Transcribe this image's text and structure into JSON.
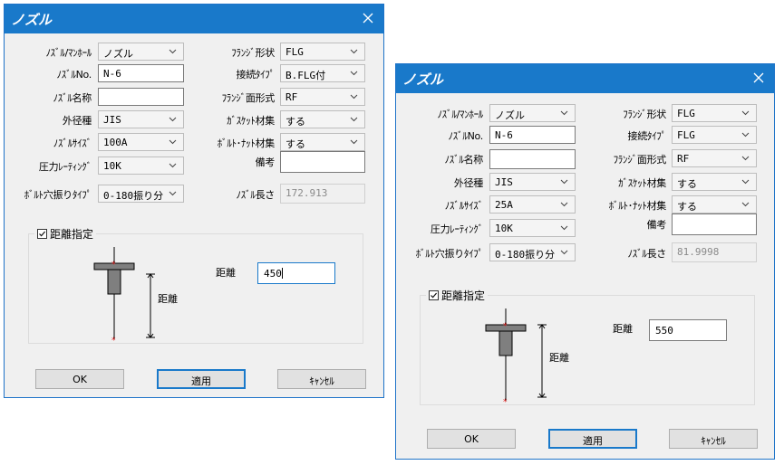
{
  "dialogs": [
    {
      "title": "ノズル",
      "fields": {
        "nozzle_manhole": {
          "label": "ﾉｽﾞﾙ/ﾏﾝﾎｰﾙ",
          "value": "ノズル"
        },
        "nozzle_no": {
          "label": "ﾉｽﾞﾙNo.",
          "value": "N-6"
        },
        "nozzle_name": {
          "label": "ﾉｽﾞﾙ名称",
          "value": ""
        },
        "outer_diameter": {
          "label": "外径種",
          "value": "JIS"
        },
        "nozzle_size": {
          "label": "ﾉｽﾞﾙｻｲｽﾞ",
          "value": "100A"
        },
        "pressure_rating": {
          "label": "圧力ﾚｰﾃｨﾝｸﾞ",
          "value": "10K"
        },
        "bolt_hole": {
          "label": "ﾎﾞﾙﾄ穴振りﾀｲﾌﾟ",
          "value": "0-180振り分"
        },
        "flange_shape": {
          "label": "ﾌﾗﾝｼﾞ形状",
          "value": "FLG"
        },
        "connection_type": {
          "label": "接続ﾀｲﾌﾟ",
          "value": "B.FLG付"
        },
        "flange_face": {
          "label": "ﾌﾗﾝｼﾞ面形式",
          "value": "RF"
        },
        "gasket": {
          "label": "ｶﾞｽｹｯﾄ材集",
          "value": "する"
        },
        "bolt_nut": {
          "label": "ﾎﾞﾙﾄ･ﾅｯﾄ材集",
          "value": "する"
        },
        "remarks": {
          "label": "備考",
          "value": ""
        },
        "nozzle_length": {
          "label": "ﾉｽﾞﾙ長さ",
          "value": "172.913"
        }
      },
      "distance_group": {
        "label": "距離指定",
        "checked": true,
        "figure_label": "距離",
        "distance_label": "距離",
        "distance_value": "450"
      },
      "buttons": {
        "ok": "OK",
        "apply": "適用",
        "cancel": "ｷｬﾝｾﾙ"
      }
    },
    {
      "title": "ノズル",
      "fields": {
        "nozzle_manhole": {
          "label": "ﾉｽﾞﾙ/ﾏﾝﾎｰﾙ",
          "value": "ノズル"
        },
        "nozzle_no": {
          "label": "ﾉｽﾞﾙNo.",
          "value": "N-6"
        },
        "nozzle_name": {
          "label": "ﾉｽﾞﾙ名称",
          "value": ""
        },
        "outer_diameter": {
          "label": "外径種",
          "value": "JIS"
        },
        "nozzle_size": {
          "label": "ﾉｽﾞﾙｻｲｽﾞ",
          "value": "25A"
        },
        "pressure_rating": {
          "label": "圧力ﾚｰﾃｨﾝｸﾞ",
          "value": "10K"
        },
        "bolt_hole": {
          "label": "ﾎﾞﾙﾄ穴振りﾀｲﾌﾟ",
          "value": "0-180振り分"
        },
        "flange_shape": {
          "label": "ﾌﾗﾝｼﾞ形状",
          "value": "FLG"
        },
        "connection_type": {
          "label": "接続ﾀｲﾌﾟ",
          "value": "FLG"
        },
        "flange_face": {
          "label": "ﾌﾗﾝｼﾞ面形式",
          "value": "RF"
        },
        "gasket": {
          "label": "ｶﾞｽｹｯﾄ材集",
          "value": "する"
        },
        "bolt_nut": {
          "label": "ﾎﾞﾙﾄ･ﾅｯﾄ材集",
          "value": "する"
        },
        "remarks": {
          "label": "備考",
          "value": ""
        },
        "nozzle_length": {
          "label": "ﾉｽﾞﾙ長さ",
          "value": "81.9998"
        }
      },
      "distance_group": {
        "label": "距離指定",
        "checked": true,
        "figure_label": "距離",
        "distance_label": "距離",
        "distance_value": "550"
      },
      "buttons": {
        "ok": "OK",
        "apply": "適用",
        "cancel": "ｷｬﾝｾﾙ"
      }
    }
  ],
  "colors": {
    "titlebar": "#1979ca",
    "dialog_bg": "#f0f0f0",
    "marker": "#e02020",
    "nozzle_fill": "#7f7f7f"
  },
  "icons": {
    "close": "close-icon",
    "dropdown": "chevron-down-icon",
    "checkbox": "checkbox-checked-icon"
  }
}
